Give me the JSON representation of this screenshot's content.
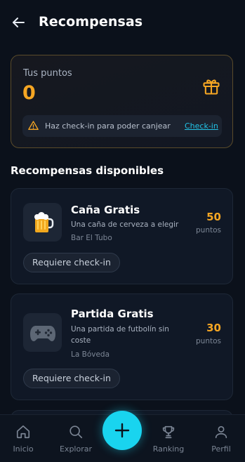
{
  "header": {
    "title": "Recompensas",
    "back_icon": "arrow-left-icon"
  },
  "points": {
    "label": "Tus puntos",
    "value": "0",
    "icon": "gift-icon",
    "warning_text": "Haz check-in para poder canjear",
    "warning_link": "Check-in"
  },
  "section_title": "Recompensas disponibles",
  "rewards": [
    {
      "name": "Caña Gratis",
      "description": "Una caña de cerveza a elegir",
      "venue": "Bar El Tubo",
      "points": "50",
      "points_unit": "puntos",
      "icon": "beer-icon",
      "button": "Requiere check-in"
    },
    {
      "name": "Partida Gratis",
      "description": "Una partida de futbolín sin coste",
      "venue": "La Bóveda",
      "points": "30",
      "points_unit": "puntos",
      "icon": "game-controller-icon",
      "button": "Requiere check-in"
    }
  ],
  "nav": {
    "items": [
      {
        "label": "Inicio",
        "icon": "home-icon"
      },
      {
        "label": "Explorar",
        "icon": "search-icon"
      },
      {
        "label": "Ranking",
        "icon": "trophy-icon"
      },
      {
        "label": "Perfil",
        "icon": "user-icon"
      }
    ],
    "fab_icon": "plus-icon"
  },
  "colors": {
    "accent": "#f5a623",
    "link": "#22c3e6",
    "fab": "#19d4ef",
    "background": "#0b111b"
  }
}
